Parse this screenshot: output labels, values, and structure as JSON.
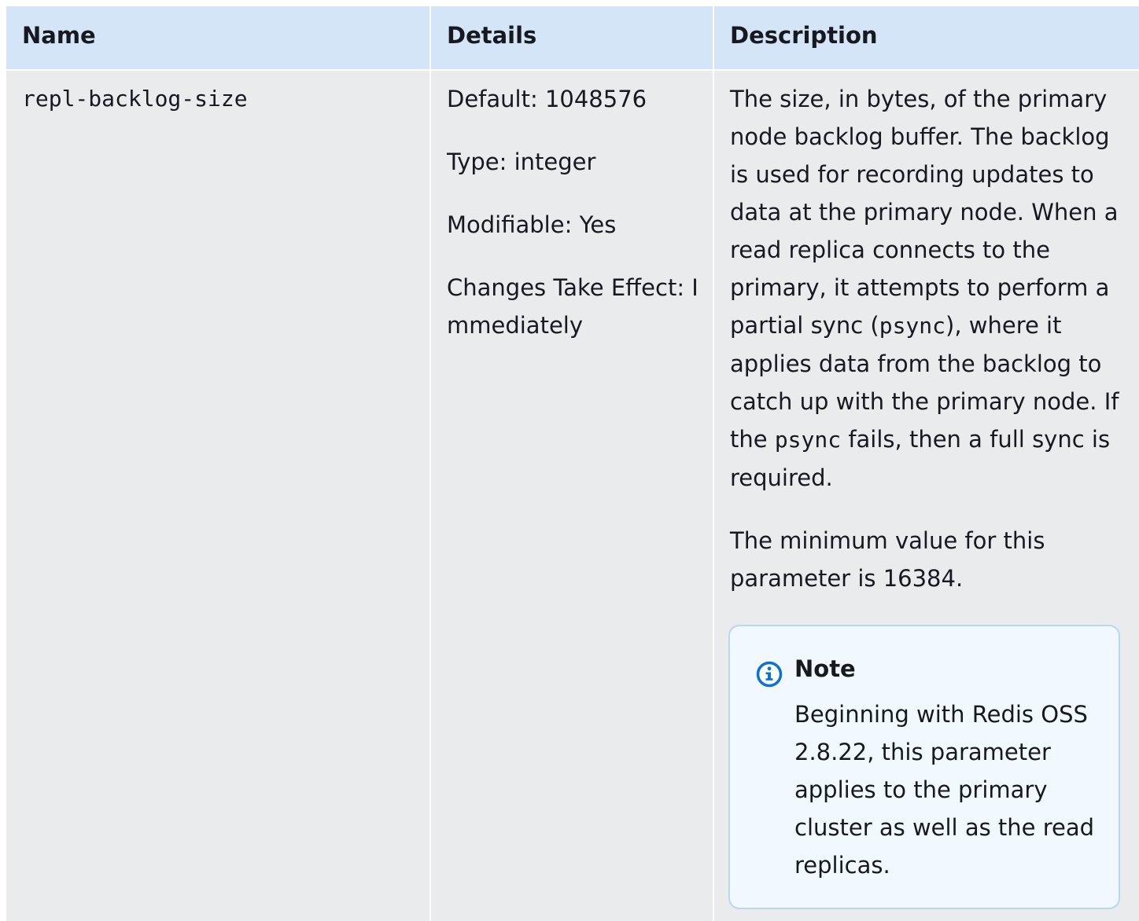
{
  "table": {
    "headers": {
      "name": "Name",
      "details": "Details",
      "description": "Description"
    },
    "row": {
      "name": "repl-backlog-size",
      "details": {
        "default": "Default: 1048576",
        "type": "Type: integer",
        "modifiable": "Modifiable: Yes",
        "changes_take_effect": "Changes Take Effect: Immediately"
      },
      "description": {
        "p1_a": "The size, in bytes, of the primary node backlog buffer. The  backlog is used for recording updates to data at the primary  node. When a read replica connects to the primary, it attempts  to perform a partial sync (",
        "p1_code1": "psync",
        "p1_b": "), where it applies  data from the backlog to catch up with the primary node. If the ",
        "p1_code2": "psync",
        "p1_c": " fails, then a full sync is  required.",
        "p2": "The minimum value for this parameter is 16384."
      },
      "note": {
        "icon": "info-icon",
        "title": "Note",
        "body": "Beginning with Redis OSS 2.8.22, this parameter applies to the  primary cluster as well as the read replicas."
      }
    }
  },
  "colors": {
    "header_bg": "#d4e5f7",
    "cell_bg": "#e9ebed",
    "note_bg": "#f1f8fe",
    "note_border": "#b8d7f5",
    "info_icon": "#0972d3"
  }
}
